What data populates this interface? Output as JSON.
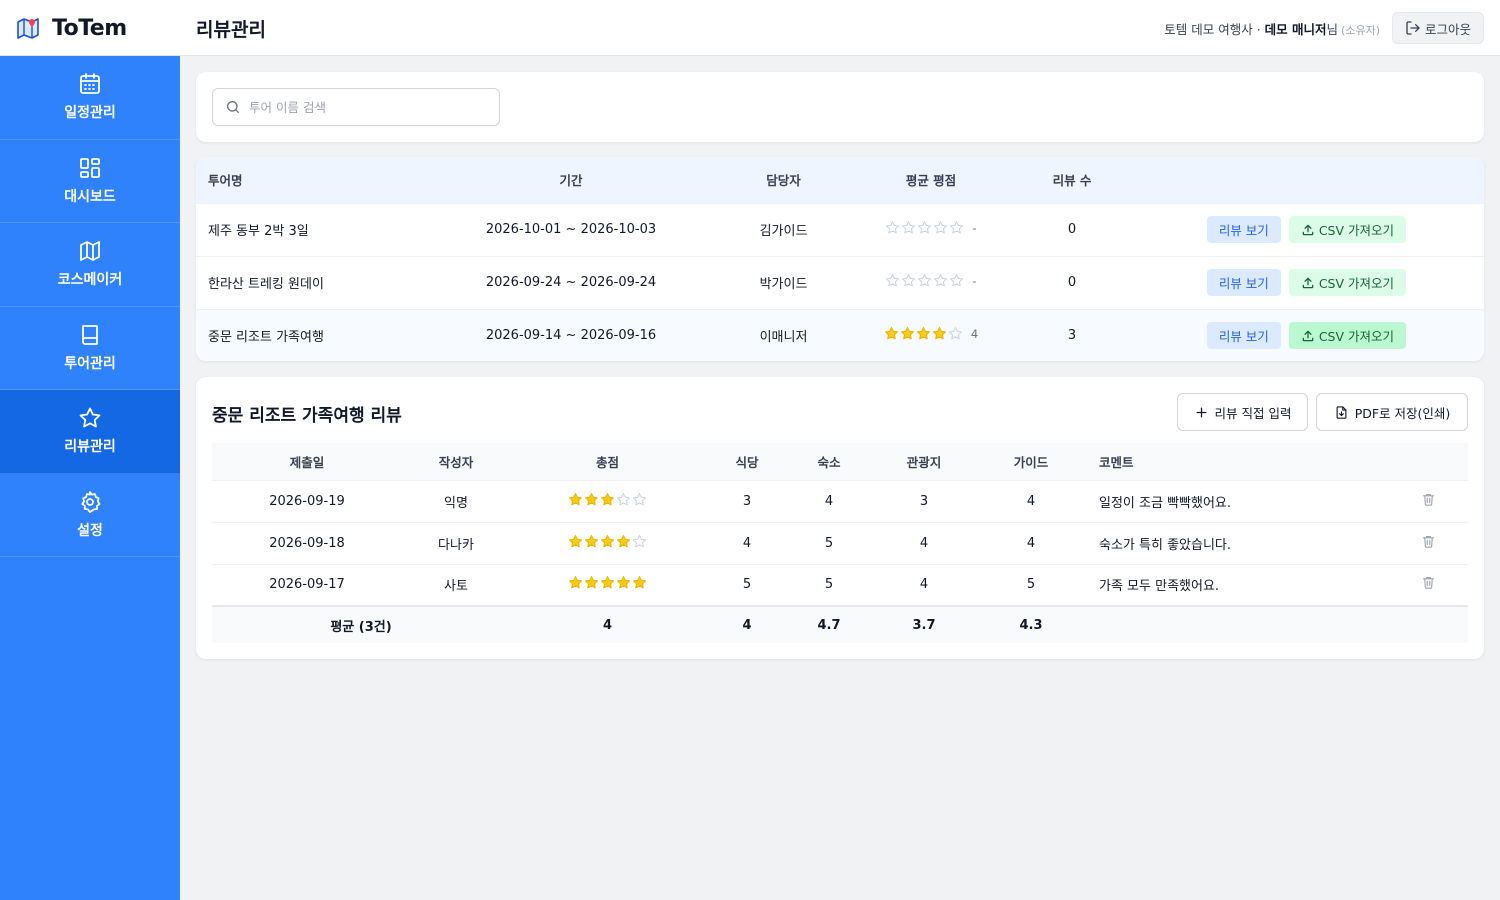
{
  "app": {
    "name": "ToTem",
    "page_title": "리뷰관리"
  },
  "header": {
    "company": "토템 데모 여행사 · ",
    "user_name": "데모 매니저",
    "user_suffix": "님",
    "role": "(소유자)",
    "logout_label": "로그아웃"
  },
  "sidebar": {
    "items": [
      {
        "label": "일정관리",
        "icon": "calendar-icon",
        "active": false
      },
      {
        "label": "대시보드",
        "icon": "dashboard-grid-icon",
        "active": false
      },
      {
        "label": "코스메이커",
        "icon": "map-icon",
        "active": false
      },
      {
        "label": "투어관리",
        "icon": "book-icon",
        "active": false
      },
      {
        "label": "리뷰관리",
        "icon": "star-icon",
        "active": true
      },
      {
        "label": "설정",
        "icon": "gear-icon",
        "active": false
      }
    ]
  },
  "search": {
    "placeholder": "투어 이름 검색",
    "value": ""
  },
  "tours_table": {
    "columns": [
      "투어명",
      "기간",
      "담당자",
      "평균 평점",
      "리뷰 수"
    ],
    "view_label": "리뷰 보기",
    "csv_label": "CSV 가져오기",
    "rows": [
      {
        "name": "제주 동부 2박 3일",
        "period": "2026-10-01 ~ 2026-10-03",
        "manager": "김가이드",
        "rating": 0,
        "rating_text": "-",
        "count": "0"
      },
      {
        "name": "한라산 트레킹 원데이",
        "period": "2026-09-24 ~ 2026-09-24",
        "manager": "박가이드",
        "rating": 0,
        "rating_text": "-",
        "count": "0"
      },
      {
        "name": "중문 리조트 가족여행",
        "period": "2026-09-14 ~ 2026-09-16",
        "manager": "이매니저",
        "rating": 4,
        "rating_text": "4",
        "count": "3"
      }
    ]
  },
  "reviews": {
    "title": "중문 리조트 가족여행 리뷰",
    "add_label": "리뷰 직접 입력",
    "pdf_label": "PDF로 저장(인쇄)",
    "columns": [
      "제출일",
      "작성자",
      "총점",
      "식당",
      "숙소",
      "관광지",
      "가이드",
      "코멘트"
    ],
    "rows": [
      {
        "date": "2026-09-19",
        "author": "익명",
        "total": 3,
        "restaurant": "3",
        "lodging": "4",
        "attraction": "3",
        "guide": "4",
        "comment": "일정이 조금 빡빡했어요."
      },
      {
        "date": "2026-09-18",
        "author": "다나카",
        "total": 4,
        "restaurant": "4",
        "lodging": "5",
        "attraction": "4",
        "guide": "4",
        "comment": "숙소가 특히 좋았습니다."
      },
      {
        "date": "2026-09-17",
        "author": "사토",
        "total": 5,
        "restaurant": "5",
        "lodging": "5",
        "attraction": "4",
        "guide": "5",
        "comment": "가족 모두 만족했어요."
      }
    ],
    "average": {
      "label": "평균 (3건)",
      "total": "4",
      "restaurant": "4",
      "lodging": "4.7",
      "attraction": "3.7",
      "guide": "4.3"
    }
  },
  "colors": {
    "sidebar": "#2f82fb",
    "sidebar_active": "#1568e4",
    "star_filled": "#facc15",
    "star_empty": "#cbd5e1"
  }
}
